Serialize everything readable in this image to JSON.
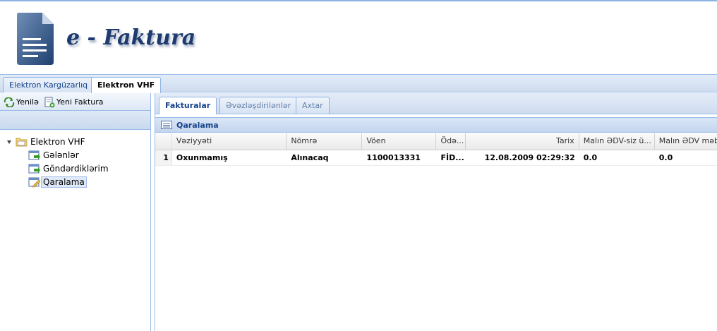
{
  "app": {
    "logo_text": "e - Faktura"
  },
  "main_tabs": [
    {
      "label": "Elektron Kargüzarlıq",
      "active": false
    },
    {
      "label": "Elektron VHF",
      "active": true
    }
  ],
  "left_toolbar": {
    "refresh_label": "Yenilə",
    "new_invoice_label": "Yeni Faktura"
  },
  "tree": {
    "root": {
      "label": "Elektron VHF",
      "expanded": true
    },
    "children": [
      {
        "label": "Gələnlər",
        "icon": "inbox-icon"
      },
      {
        "label": "Göndərdiklərim",
        "icon": "outbox-icon"
      },
      {
        "label": "Qaralama",
        "icon": "draft-icon",
        "selected": true
      }
    ]
  },
  "sub_tabs": [
    {
      "label": "Fakturalar",
      "active": true
    },
    {
      "label": "Əvəzləşdirilənlər",
      "active": false
    },
    {
      "label": "Axtar",
      "active": false
    }
  ],
  "grid": {
    "title": "Qaralama",
    "columns": [
      "",
      "Vəziyyəti",
      "Nömrə",
      "Vöen",
      "Ödə...",
      "Tarix",
      "Malın ƏDV-siz ü...",
      "Malın ƏDV məb"
    ],
    "rows": [
      [
        "1",
        "Oxunmamış",
        "Alınacaq",
        "1100013331",
        "FİD...",
        "12.08.2009 02:29:32",
        "0.0",
        "0.0"
      ]
    ]
  },
  "colors": {
    "accent": "#15428b",
    "border": "#99bbe8",
    "header_bg": "#dfe8f6"
  }
}
